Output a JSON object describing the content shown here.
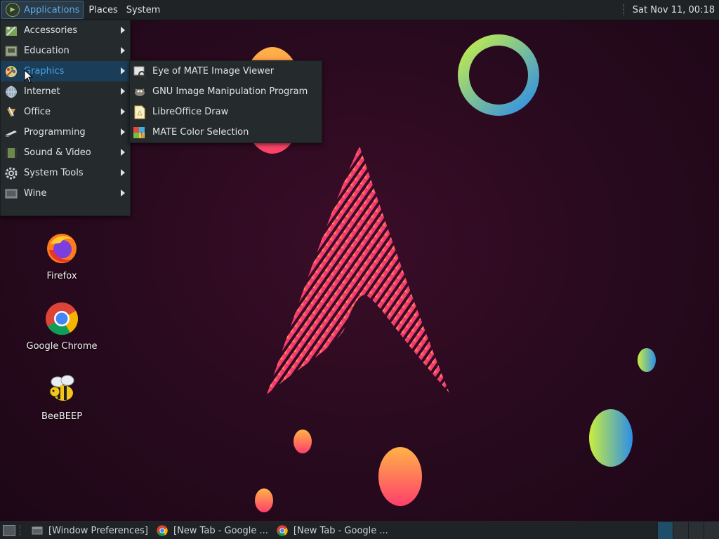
{
  "top_panel": {
    "menus": [
      "Applications",
      "Places",
      "System"
    ],
    "clock": "Sat Nov 11, 00:18"
  },
  "app_menu": {
    "items": [
      {
        "label": "Accessories",
        "icon": "accessories-icon"
      },
      {
        "label": "Education",
        "icon": "education-icon"
      },
      {
        "label": "Graphics",
        "icon": "graphics-icon",
        "highlighted": true
      },
      {
        "label": "Internet",
        "icon": "internet-globe-icon"
      },
      {
        "label": "Office",
        "icon": "office-icon"
      },
      {
        "label": "Programming",
        "icon": "programming-icon"
      },
      {
        "label": "Sound & Video",
        "icon": "sound-video-icon"
      },
      {
        "label": "System Tools",
        "icon": "gear-icon"
      },
      {
        "label": "Wine",
        "icon": "wine-icon"
      }
    ]
  },
  "graphics_submenu": {
    "items": [
      {
        "label": "Eye of MATE Image Viewer",
        "icon": "image-viewer-icon"
      },
      {
        "label": "GNU Image Manipulation Program",
        "icon": "gimp-icon"
      },
      {
        "label": "LibreOffice Draw",
        "icon": "libreoffice-draw-icon"
      },
      {
        "label": "MATE Color Selection",
        "icon": "color-selection-icon"
      }
    ]
  },
  "desktop_icons": [
    {
      "label": "Firefox",
      "icon": "firefox-icon"
    },
    {
      "label": "Google Chrome",
      "icon": "chrome-icon"
    },
    {
      "label": "BeeBEEP",
      "icon": "bee-icon"
    }
  ],
  "taskbar": {
    "tasks": [
      "[Window Preferences]",
      "[New Tab - Google ...",
      "[New Tab - Google ..."
    ]
  },
  "colors": {
    "panel": "#1f2326",
    "menu_bg": "#252a2d",
    "highlight": "#1a3e5a",
    "accent": "#4aa3df",
    "wallpaper": "#2a0a1f"
  }
}
